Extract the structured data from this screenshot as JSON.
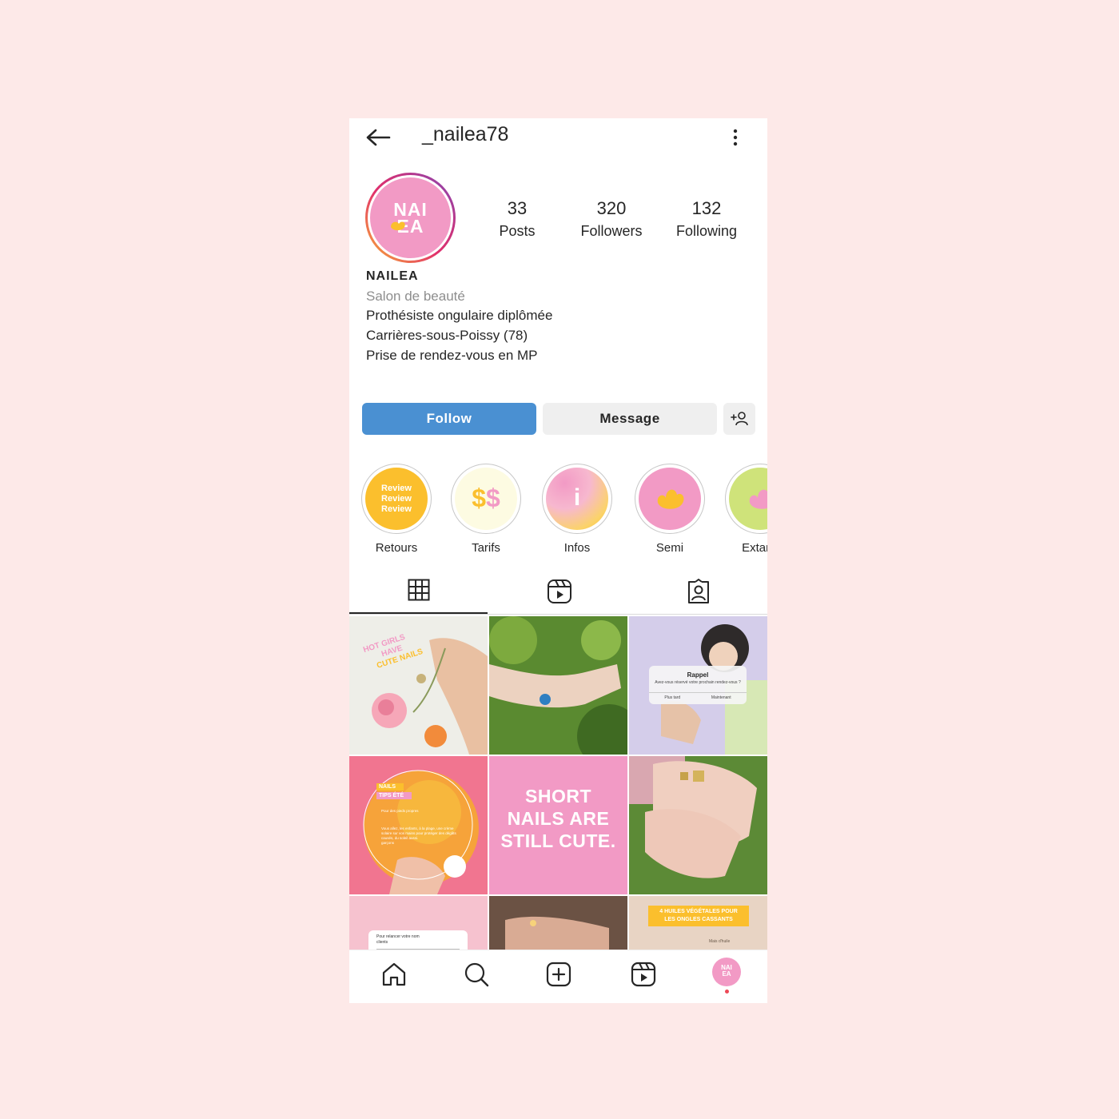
{
  "header": {
    "username": "_nailea78"
  },
  "profile": {
    "avatar_text_line1": "NAI",
    "avatar_text_line2": "EA",
    "stats": [
      {
        "value": "33",
        "label": "Posts"
      },
      {
        "value": "320",
        "label": "Followers"
      },
      {
        "value": "132",
        "label": "Following"
      }
    ],
    "name": "NAILEA",
    "category": "Salon de beauté",
    "bio": [
      "Prothésiste ongulaire diplômée",
      "Carrières-sous-Poissy (78)",
      "Prise de rendez-vous en MP"
    ]
  },
  "actions": {
    "follow": "Follow",
    "message": "Message"
  },
  "highlights": [
    {
      "label": "Retours",
      "cover_text": [
        "Review",
        "Review",
        "Review"
      ]
    },
    {
      "label": "Tarifs",
      "cover_text": [
        "$$"
      ]
    },
    {
      "label": "Infos",
      "cover_text": [
        "i"
      ]
    },
    {
      "label": "Semi"
    },
    {
      "label": "Extans"
    }
  ],
  "posts": [
    {
      "text_lines": [
        "HOT GIRLS",
        "HAVE",
        "CUTE NAILS"
      ]
    },
    {
      "text_lines": []
    },
    {
      "title": "Rappel",
      "subtitle": "Avez-vous réservé votre prochain rendez-vous ?",
      "buttons": [
        "Plus tard",
        "Maintenant"
      ]
    },
    {
      "tags": [
        "NAILS",
        "TIPS ÉTÉ"
      ],
      "lines": [
        "Pour des pieds propres",
        "Vous allez, les enfants, à la plage, une crème solaire sur vos mains pour protéger des dégâts causés, du soleil aussi.",
        "garçons"
      ]
    },
    {
      "text_lines": [
        "SHORT",
        "NAILS ARE",
        "STILL CUTE."
      ]
    },
    {
      "text_lines": []
    },
    {
      "lines": [
        "Pour relancer votre nom",
        "clients"
      ]
    },
    {
      "text_lines": []
    },
    {
      "text_lines": [
        "4 HUILES VÉGÉTALES POUR",
        "LES ONGLES CASSANTS"
      ],
      "caption": "Mais d'huile"
    }
  ],
  "colors": {
    "background": "#fde9e8",
    "brand_pink": "#f29ac5",
    "follow_blue": "#4a90d2",
    "highlight_yellow": "#fbbf2d",
    "highlight_green": "#cfe37a",
    "notification_dot": "#ed4956"
  },
  "icons": [
    "back-arrow-icon",
    "more-vertical-icon",
    "add-user-icon",
    "grid-icon",
    "reels-icon",
    "tagged-icon",
    "home-icon",
    "search-icon",
    "new-post-icon",
    "reels-icon"
  ]
}
